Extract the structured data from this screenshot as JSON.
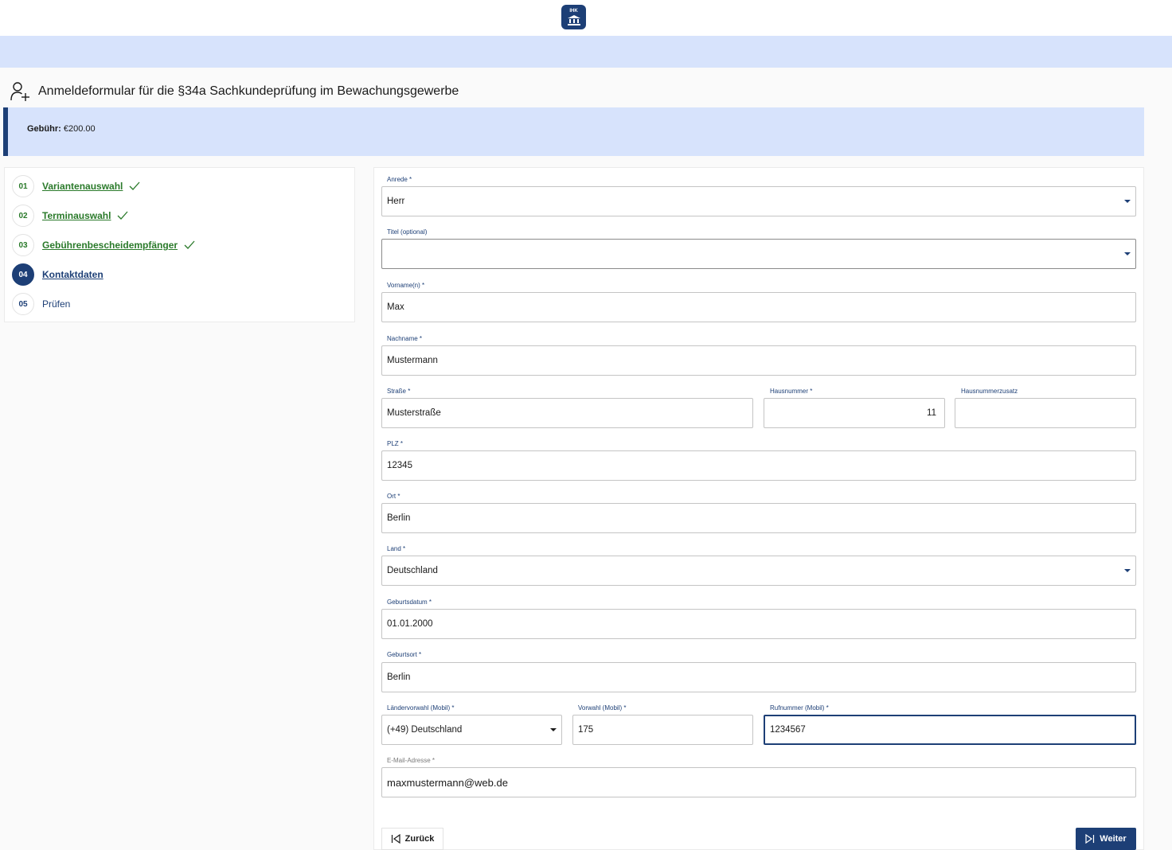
{
  "header": {
    "logo_text": "IHK"
  },
  "page": {
    "title": "Anmeldeformular für die §34a Sachkundeprüfung im Bewachungsgewerbe"
  },
  "fee": {
    "label": "Gebühr:",
    "value": "€200.00"
  },
  "steps": [
    {
      "num": "01",
      "label": "Variantenauswahl",
      "state": "done"
    },
    {
      "num": "02",
      "label": "Terminauswahl",
      "state": "done"
    },
    {
      "num": "03",
      "label": "Gebührenbescheidempfänger",
      "state": "done"
    },
    {
      "num": "04",
      "label": "Kontaktdaten",
      "state": "active"
    },
    {
      "num": "05",
      "label": "Prüfen",
      "state": "todo"
    }
  ],
  "form": {
    "anrede": {
      "label": "Anrede *",
      "value": "Herr"
    },
    "titel": {
      "label": "Titel (optional)",
      "value": ""
    },
    "vorname": {
      "label": "Vorname(n) *",
      "value": "Max"
    },
    "nachname": {
      "label": "Nachname *",
      "value": "Mustermann"
    },
    "strasse": {
      "label": "Straße *",
      "value": "Musterstraße"
    },
    "hausnummer": {
      "label": "Hausnummer *",
      "value": "11"
    },
    "zusatz": {
      "label": "Hausnummerzusatz",
      "value": ""
    },
    "plz": {
      "label": "PLZ *",
      "value": "12345"
    },
    "ort": {
      "label": "Ort *",
      "value": "Berlin"
    },
    "land": {
      "label": "Land *",
      "value": "Deutschland"
    },
    "geburtsdatum": {
      "label": "Geburtsdatum *",
      "value": "01.01.2000"
    },
    "geburtsort": {
      "label": "Geburtsort *",
      "value": "Berlin"
    },
    "laendervorwahl": {
      "label": "Ländervorwahl (Mobil) *",
      "value": "(+49) Deutschland"
    },
    "vorwahl": {
      "label": "Vorwahl (Mobil) *",
      "value": "175"
    },
    "rufnummer": {
      "label": "Rufnummer (Mobil) *",
      "value": "1234567"
    },
    "email": {
      "label": "E-Mail-Adresse *",
      "value": "maxmustermann@web.de"
    }
  },
  "buttons": {
    "back": "Zurück",
    "next": "Weiter"
  },
  "colors": {
    "primary": "#1d3f76",
    "band": "#d7e3fc",
    "success": "#2a7a2a"
  }
}
